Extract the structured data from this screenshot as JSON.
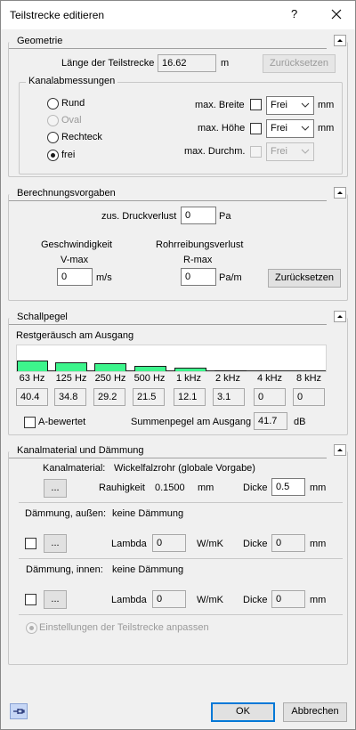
{
  "window": {
    "title": "Teilstrecke editieren",
    "help_label": "?",
    "close_icon": "close-icon"
  },
  "geometrie": {
    "title": "Geometrie",
    "length_label": "Länge der Teilstrecke",
    "length_value": "16.62",
    "length_unit": "m",
    "reset_label": "Zurücksetzen",
    "kanal_title": "Kanalabmessungen",
    "shapes": [
      {
        "label": "Rund",
        "selected": false,
        "enabled": true
      },
      {
        "label": "Oval",
        "selected": false,
        "enabled": false
      },
      {
        "label": "Rechteck",
        "selected": false,
        "enabled": true
      },
      {
        "label": "frei",
        "selected": true,
        "enabled": true
      }
    ],
    "max_breite_label": "max. Breite",
    "max_breite_value": "Frei",
    "max_hoehe_label": "max. Höhe",
    "max_hoehe_value": "Frei",
    "max_durchm_label": "max. Durchm.",
    "max_durchm_value": "Frei",
    "unit_mm": "mm"
  },
  "berechnung": {
    "title": "Berechnungsvorgaben",
    "druck_label": "zus. Druckverlust",
    "druck_value": "0",
    "druck_unit": "Pa",
    "geschw_label": "Geschwindigkeit",
    "vmax_label": "V-max",
    "vmax_value": "0",
    "vmax_unit": "m/s",
    "rohr_label": "Rohrreibungsverlust",
    "rmax_label": "R-max",
    "rmax_value": "0",
    "rmax_unit": "Pa/m",
    "reset_label": "Zurücksetzen"
  },
  "schall": {
    "title": "Schallpegel",
    "rest_label": "Restgeräusch am Ausgang",
    "bars": [
      {
        "freq": "63 Hz",
        "value": "40.4",
        "level": 40.4
      },
      {
        "freq": "125 Hz",
        "value": "34.8",
        "level": 34.8
      },
      {
        "freq": "250 Hz",
        "value": "29.2",
        "level": 29.2
      },
      {
        "freq": "500 Hz",
        "value": "21.5",
        "level": 21.5
      },
      {
        "freq": "1 kHz",
        "value": "12.1",
        "level": 12.1
      },
      {
        "freq": "2 kHz",
        "value": "3.1",
        "level": 3.1
      },
      {
        "freq": "4 kHz",
        "value": "0",
        "level": 0
      },
      {
        "freq": "8 kHz",
        "value": "0",
        "level": 0
      }
    ],
    "bar_color": "#3df58c",
    "abewertet_label": "A-bewertet",
    "summen_label": "Summenpegel am Ausgang",
    "summen_value": "41.7",
    "summen_unit": "dB"
  },
  "material": {
    "title": "Kanalmaterial und Dämmung",
    "kanal_label": "Kanalmaterial:",
    "kanal_value": "Wickelfalzrohr (globale Vorgabe)",
    "browse_label": "...",
    "rauh_label": "Rauhigkeit",
    "rauh_value": "0.1500",
    "rauh_unit": "mm",
    "dicke_label": "Dicke",
    "kanal_dicke": "0.5",
    "unit_mm": "mm",
    "daemm_aussen_label": "Dämmung, außen:",
    "daemm_aussen_value": "keine Dämmung",
    "lambda_label": "Lambda",
    "aussen_lambda": "0",
    "lambda_unit": "W/mK",
    "aussen_dicke": "0",
    "daemm_innen_label": "Dämmung, innen:",
    "daemm_innen_value": "keine Dämmung",
    "innen_lambda": "0",
    "innen_dicke": "0",
    "einstellungen_label": "Einstellungen der Teilstrecke anpassen"
  },
  "footer": {
    "ok_label": "OK",
    "cancel_label": "Abbrechen"
  }
}
